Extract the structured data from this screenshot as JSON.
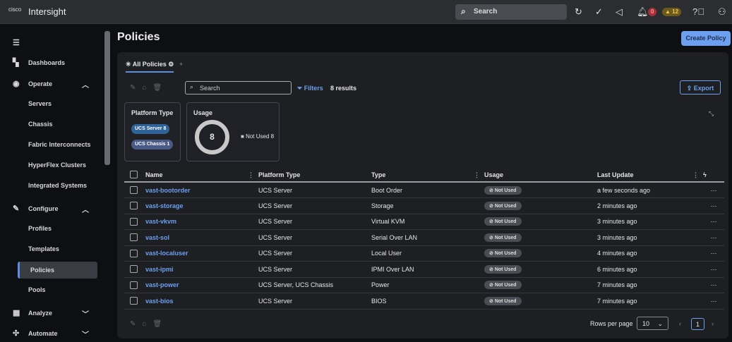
{
  "topbar": {
    "logo": "cisco",
    "brand": "Intersight",
    "search": "Search",
    "alert_critical": "0",
    "alert_warning": "12"
  },
  "sidebar": {
    "items": [
      {
        "label": "Dashboards",
        "icon": "dashboard-icon"
      },
      {
        "label": "Operate",
        "icon": "operate-icon"
      },
      {
        "label": "Servers"
      },
      {
        "label": "Chassis"
      },
      {
        "label": "Fabric Interconnects"
      },
      {
        "label": "HyperFlex Clusters"
      },
      {
        "label": "Integrated Systems"
      },
      {
        "label": "Configure",
        "icon": "wrench-icon"
      },
      {
        "label": "Profiles"
      },
      {
        "label": "Templates"
      },
      {
        "label": "Policies"
      },
      {
        "label": "Pools"
      },
      {
        "label": "Analyze",
        "icon": "analyze-icon"
      },
      {
        "label": "Automate",
        "icon": "automate-icon"
      }
    ]
  },
  "page": {
    "title": "Policies",
    "create": "Create Policy"
  },
  "tabs": {
    "all": "All Policies",
    "add": "+"
  },
  "toolbar": {
    "search_placeholder": "Search",
    "filters": "Filters",
    "results": "8 results",
    "export": "Export"
  },
  "summary": {
    "platform_title": "Platform Type",
    "pill1": "UCS Server 8",
    "pill2": "UCS Chassis 1",
    "usage_title": "Usage",
    "usage_total": "8",
    "legend": "Not Used 8"
  },
  "table": {
    "headers": [
      "Name",
      "Platform Type",
      "Type",
      "Usage",
      "Last Update"
    ],
    "rows": [
      [
        "vast-bootorder",
        "UCS Server",
        "Boot Order",
        "Not Used",
        "a few seconds ago"
      ],
      [
        "vast-storage",
        "UCS Server",
        "Storage",
        "Not Used",
        "2 minutes ago"
      ],
      [
        "vast-vkvm",
        "UCS Server",
        "Virtual KVM",
        "Not Used",
        "3 minutes ago"
      ],
      [
        "vast-sol",
        "UCS Server",
        "Serial Over LAN",
        "Not Used",
        "3 minutes ago"
      ],
      [
        "vast-localuser",
        "UCS Server",
        "Local User",
        "Not Used",
        "4 minutes ago"
      ],
      [
        "vast-ipmi",
        "UCS Server",
        "IPMI Over LAN",
        "Not Used",
        "6 minutes ago"
      ],
      [
        "vast-power",
        "UCS Server, UCS Chassis",
        "Power",
        "Not Used",
        "7 minutes ago"
      ],
      [
        "vast-bios",
        "UCS Server",
        "BIOS",
        "Not Used",
        "7 minutes ago"
      ]
    ]
  },
  "footer": {
    "rows_per_page_label": "Rows per page",
    "rows_per_page": "10",
    "page": "1"
  }
}
